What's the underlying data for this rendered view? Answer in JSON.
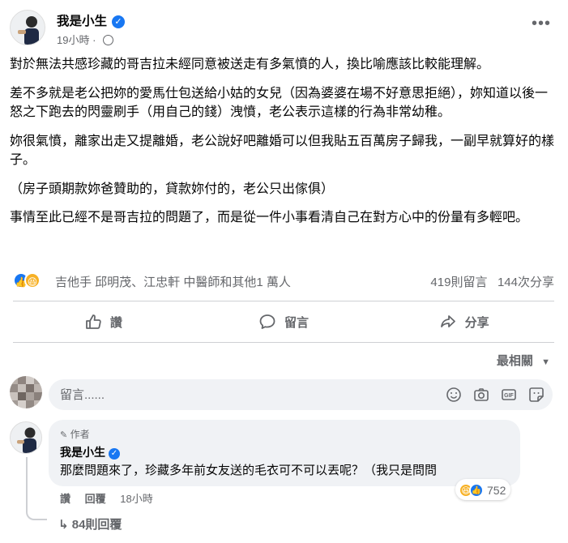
{
  "post": {
    "author": "我是小生",
    "time": "19小時",
    "paragraphs": [
      "對於無法共感珍藏的哥吉拉未經同意被送走有多氣憤的人，換比喻應該比較能理解。",
      "差不多就是老公把妳的愛馬仕包送給小姑的女兒（因為婆婆在場不好意思拒絕），妳知道以後一怒之下跑去的閃靈刷手（用自己的錢）洩憤，老公表示這樣的行為非常幼稚。",
      "妳很氣憤，離家出走又提離婚，老公說好吧離婚可以但我貼五百萬房子歸我，一副早就算好的樣子。",
      "（房子頭期款妳爸贊助的，貸款妳付的，老公只出傢俱）",
      "事情至此已經不是哥吉拉的問題了，而是從一件小事看清自己在對方心中的份量有多輕吧。"
    ]
  },
  "reactions": {
    "names": "吉他手 邱明茂、江忠軒 中醫師和其他1 萬人",
    "comments": "419則留言",
    "shares": "144次分享"
  },
  "actions": {
    "like": "讚",
    "comment": "留言",
    "share": "分享"
  },
  "sort_label": "最相關",
  "composer": {
    "placeholder": "留言......"
  },
  "top_comment": {
    "tag": "作者",
    "name": "我是小生",
    "text": "那麼問題來了，珍藏多年前女友送的毛衣可不可以丟呢？（我只是問問",
    "reaction_count": "752",
    "like_label": "讚",
    "reply_label": "回覆",
    "time": "18小時",
    "replies_link": "84則回覆"
  },
  "colors": {
    "accent": "#1877f2",
    "muted": "#65676b",
    "bubble": "#f0f2f5"
  }
}
